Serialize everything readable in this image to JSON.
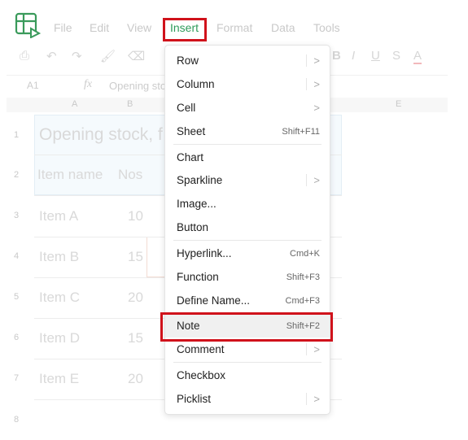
{
  "menubar": {
    "items": [
      "File",
      "Edit",
      "View",
      "Insert",
      "Format",
      "Data",
      "Tools"
    ],
    "active": "Insert"
  },
  "toolbar": {
    "bold": "B",
    "italic": "I",
    "underline": "U",
    "strike": "S",
    "font_color": "A"
  },
  "formula_bar": {
    "cell_ref": "A1",
    "fx": "fx",
    "content": "Opening sto"
  },
  "columns": [
    "A",
    "B",
    "E"
  ],
  "rows": [
    {
      "num": "1",
      "a": "Opening stock, f",
      "b": ""
    },
    {
      "num": "2",
      "a": "Item name",
      "b": "Nos"
    },
    {
      "num": "3",
      "a": "Item A",
      "b": "10"
    },
    {
      "num": "4",
      "a": "Item B",
      "b": "15"
    },
    {
      "num": "5",
      "a": "Item C",
      "b": "20"
    },
    {
      "num": "6",
      "a": "Item D",
      "b": "15"
    },
    {
      "num": "7",
      "a": "Item E",
      "b": "20"
    },
    {
      "num": "8",
      "a": "",
      "b": ""
    }
  ],
  "insert_menu": {
    "items": [
      {
        "label": "Row",
        "shortcut": "",
        "submenu": true
      },
      {
        "label": "Column",
        "shortcut": "",
        "submenu": true
      },
      {
        "label": "Cell",
        "shortcut": "",
        "submenu": true
      },
      {
        "label": "Sheet",
        "shortcut": "Shift+F11",
        "submenu": false
      },
      {
        "label": "Chart",
        "shortcut": "",
        "submenu": false
      },
      {
        "label": "Sparkline",
        "shortcut": "",
        "submenu": true
      },
      {
        "label": "Image...",
        "shortcut": "",
        "submenu": false
      },
      {
        "label": "Button",
        "shortcut": "",
        "submenu": false
      },
      {
        "label": "Hyperlink...",
        "shortcut": "Cmd+K",
        "submenu": false
      },
      {
        "label": "Function",
        "shortcut": "Shift+F3",
        "submenu": false
      },
      {
        "label": "Define Name...",
        "shortcut": "Cmd+F3",
        "submenu": false
      },
      {
        "label": "Note",
        "shortcut": "Shift+F2",
        "submenu": false,
        "highlighted": true
      },
      {
        "label": "Comment",
        "shortcut": "",
        "submenu": true
      },
      {
        "label": "Checkbox",
        "shortcut": "",
        "submenu": false
      },
      {
        "label": "Picklist",
        "shortcut": "",
        "submenu": true
      }
    ],
    "arrow": ">"
  },
  "colors": {
    "accent": "#2e9b5a",
    "highlight_box": "#d0121b"
  }
}
